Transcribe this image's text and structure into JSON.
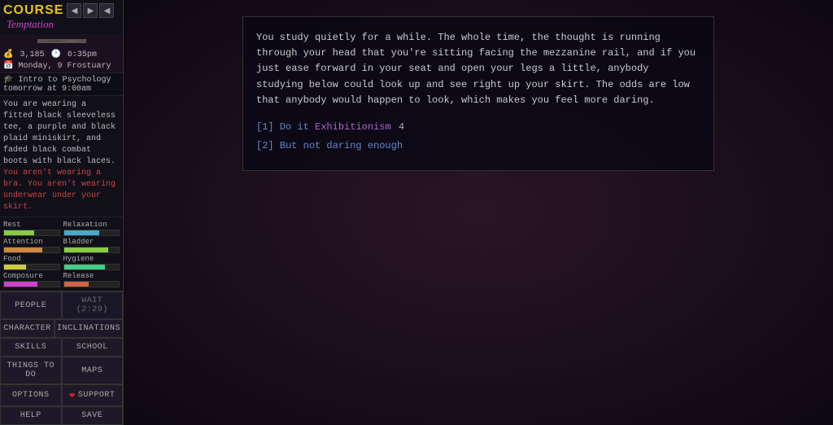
{
  "sidebar": {
    "title": "COURSE",
    "subtitle": "Temptation",
    "nav": {
      "back_label": "◀",
      "forward_label": "▶",
      "close_label": "◀"
    },
    "stats": {
      "money": "3,185",
      "time": "6:35pm",
      "date": "Monday, 9 Frostuary"
    },
    "event": "Intro to Psychology tomorrow at 9:00am",
    "clothing": "You are wearing a fitted black sleeveless tee, a purple and black plaid miniskirt, and faded black combat boots with black laces.",
    "clothing_warning": "You aren't wearing a bra. You aren't wearing underwear under your skirt.",
    "bars": [
      {
        "label": "Rest",
        "class": "bar-rest"
      },
      {
        "label": "Relaxation",
        "class": "bar-relaxation"
      },
      {
        "label": "Attention",
        "class": "bar-attention"
      },
      {
        "label": "Bladder",
        "class": "bar-bladder"
      },
      {
        "label": "Food",
        "class": "bar-food"
      },
      {
        "label": "Hygiene",
        "class": "bar-hygiene"
      },
      {
        "label": "Composure",
        "class": "bar-composure"
      },
      {
        "label": "Release",
        "class": "bar-release"
      }
    ],
    "bottom_buttons": {
      "people": "PEOPLE",
      "wait": "WAIT (2:29)",
      "character": "CHARACTER",
      "inclinations": "INCLINATIONS",
      "skills": "SKILLS",
      "school": "SCHOOL",
      "things_to_do": "THINGS TO DO",
      "maps": "MAPS",
      "options": "OPTIONS",
      "support": "SUPPORT",
      "help": "HELP",
      "save": "SAVE"
    }
  },
  "main": {
    "story_text": "You study quietly for a while. The whole time, the thought is running through your head that you're sitting facing the mezzanine rail, and if you just ease forward in your seat and open your legs a little, anybody studying below could look up and see right up your skirt. The odds are low that anybody would happen to look, which makes you feel more daring.",
    "choices": [
      {
        "number": "[1]",
        "label": "Do it",
        "tag": "Exhibitionism",
        "tag_value": "4"
      },
      {
        "number": "[2]",
        "label": "But not daring enough"
      }
    ]
  }
}
